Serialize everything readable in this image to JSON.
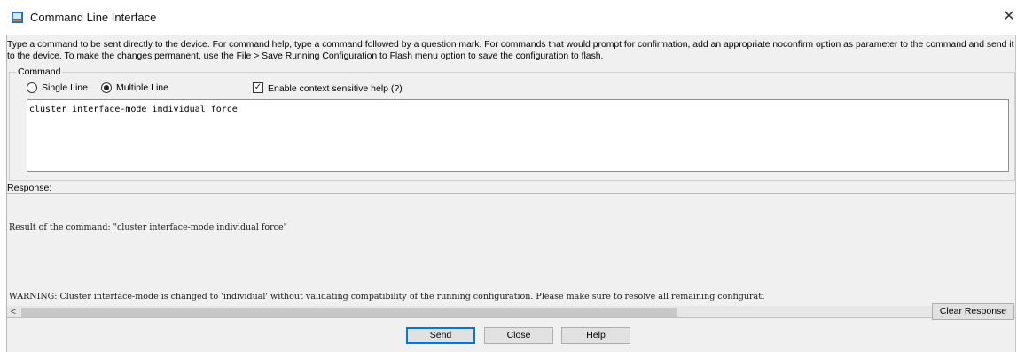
{
  "window": {
    "title": "Command Line Interface",
    "close_glyph": "✕"
  },
  "description": "Type a command to be sent directly to the device. For command help, type a command followed by a question mark. For commands that would prompt for confirmation, add an appropriate noconfirm option as parameter to the command and send it to the device. To make the changes permanent, use the File > Save Running Configuration to Flash menu option to save the configuration to flash.",
  "command": {
    "group_label": "Command",
    "mode_options": [
      {
        "label": "Single Line",
        "selected": false
      },
      {
        "label": "Multiple Line",
        "selected": true
      }
    ],
    "context_help": {
      "label": "Enable context sensitive help (?)",
      "checked": true,
      "check_glyph": "✓"
    },
    "input_value": "cluster interface-mode individual force"
  },
  "response": {
    "label": "Response:",
    "lines": [
      "Result of the command: \"cluster interface-mode individual force\"",
      "",
      "WARNING: Cluster interface-mode is changed to 'individual' without validating compatibility of the running configuration. Please make sure to resolve all remaining configurati"
    ],
    "scroll_fraction_visible": 0.67,
    "scroll_left_glyph": "<",
    "scroll_right_glyph": ">"
  },
  "buttons": {
    "clear_response": "Clear Response",
    "send": "Send",
    "close": "Close",
    "help": "Help"
  },
  "colors": {
    "panel_bg": "#f0f0f0",
    "default_button_border": "#0078d7",
    "scroll_thumb": "#c8c8c8"
  }
}
